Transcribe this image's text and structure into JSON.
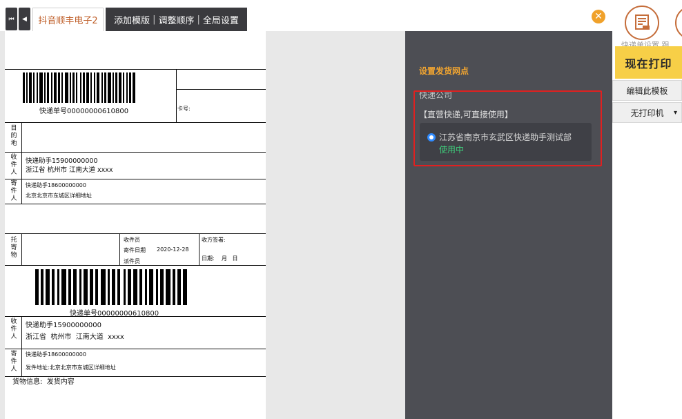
{
  "tabs": {
    "nav_first": "⏮",
    "nav_prev": "◀",
    "active_tab": "抖音顺丰电子2",
    "actions": [
      "添加模版",
      "调整顺序",
      "全局设置"
    ]
  },
  "close_glyph": "✕",
  "label": {
    "tracking_top": "快递单号00000000610800",
    "card_no": "卡号:",
    "dest_label": "目的地",
    "recipient_label": "收件人",
    "recipient_name": "快递助手15900000000",
    "recipient_addr": "浙江省  杭州市  江南大道  xxxx",
    "sender_label": "寄件人",
    "sender_name": "快递助手18600000000",
    "sender_addr": "北京北京市东城区详细地址",
    "consign_label": "托寄物",
    "collector": "收件员",
    "send_date_label": "寄件日期",
    "send_date": "2020-12-28",
    "dispatcher": "派件员",
    "receiver_sign": "收方签署:",
    "date_line": "日期:    月   日",
    "tracking_bottom": "快递单号00000000610800",
    "recipient2_name": "快递助手15900000000",
    "recipient2_addr": "浙江省  杭州市  江南大道  xxxx",
    "sender2_name": "快递助手18600000000",
    "sender2_addr": "发件地址:北京北京市东城区详细地址",
    "goods_info": "货物信息:  发货内容"
  },
  "panel": {
    "title": "设置发货网点",
    "courier_label": "快递公司",
    "direct_note": "【直营快递,可直接使用】",
    "branch_name": "江苏省南京市玄武区快递助手测试部",
    "branch_status": "使用中"
  },
  "right": {
    "faded_text": "快递单设置  跟",
    "print_now": "现在打印",
    "edit_template": "编辑此模板",
    "printer": "无打印机",
    "printer_caret": "▾"
  },
  "colors": {
    "accent": "#f2a530",
    "status_green": "#3fd07c",
    "highlight_red": "#e02020",
    "print_button": "#f7cf47"
  },
  "icons": [
    "first-page-icon",
    "prev-page-icon",
    "close-icon",
    "waybill-settings-icon",
    "secondary-icon",
    "radio-selected-icon",
    "dropdown-caret-icon"
  ]
}
